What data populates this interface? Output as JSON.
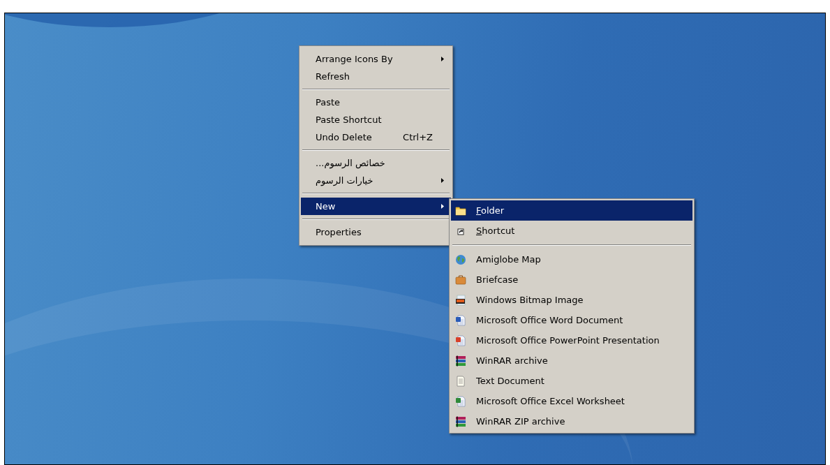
{
  "context_menu": {
    "items": [
      {
        "kind": "item",
        "label": "Arrange Icons By",
        "submenu": true,
        "selected": false
      },
      {
        "kind": "item",
        "label": "Refresh",
        "submenu": false,
        "selected": false
      },
      {
        "kind": "separator"
      },
      {
        "kind": "item",
        "label": "Paste",
        "submenu": false,
        "selected": false
      },
      {
        "kind": "item",
        "label": "Paste Shortcut",
        "submenu": false,
        "selected": false
      },
      {
        "kind": "item",
        "label": "Undo Delete",
        "shortcut": "Ctrl+Z",
        "submenu": false,
        "selected": false
      },
      {
        "kind": "separator"
      },
      {
        "kind": "item",
        "label": "خصائص الرسوم...",
        "submenu": false,
        "selected": false
      },
      {
        "kind": "item",
        "label": "خيارات الرسوم",
        "submenu": true,
        "selected": false
      },
      {
        "kind": "separator"
      },
      {
        "kind": "item",
        "label": "New",
        "submenu": true,
        "selected": true
      },
      {
        "kind": "separator"
      },
      {
        "kind": "item",
        "label": "Properties",
        "submenu": false,
        "selected": false
      }
    ]
  },
  "new_submenu": {
    "items": [
      {
        "kind": "folder",
        "label": "Folder",
        "underline_first": true,
        "selected": true
      },
      {
        "kind": "shortcut",
        "label": "Shortcut",
        "underline_first": true,
        "selected": false
      },
      {
        "kind": "separator"
      },
      {
        "kind": "map",
        "label": "Amiglobe Map",
        "underline_first": false,
        "selected": false
      },
      {
        "kind": "briefcase",
        "label": "Briefcase",
        "underline_first": false,
        "selected": false
      },
      {
        "kind": "bitmap",
        "label": "Windows Bitmap Image",
        "underline_first": false,
        "selected": false
      },
      {
        "kind": "word",
        "label": "Microsoft Office Word Document",
        "underline_first": false,
        "selected": false
      },
      {
        "kind": "powerpoint",
        "label": "Microsoft Office PowerPoint Presentation",
        "underline_first": false,
        "selected": false
      },
      {
        "kind": "archive",
        "label": "WinRAR archive",
        "underline_first": false,
        "selected": false
      },
      {
        "kind": "text",
        "label": "Text Document",
        "underline_first": false,
        "selected": false
      },
      {
        "kind": "excel",
        "label": "Microsoft Office Excel Worksheet",
        "underline_first": false,
        "selected": false
      },
      {
        "kind": "archive",
        "label": "WinRAR ZIP archive",
        "underline_first": false,
        "selected": false
      }
    ]
  }
}
